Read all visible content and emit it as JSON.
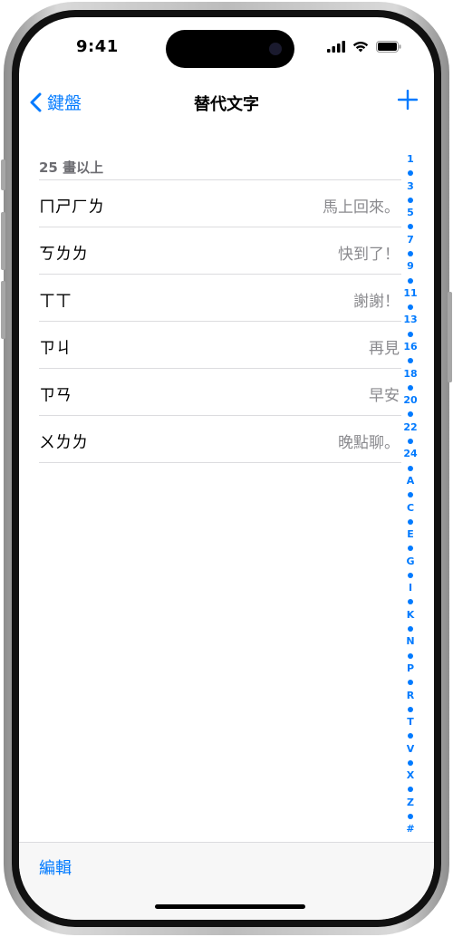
{
  "status": {
    "time": "9:41"
  },
  "nav": {
    "back_label": "鍵盤",
    "title": "替代文字"
  },
  "section": {
    "header": "25 畫以上"
  },
  "rows": [
    {
      "shortcut": "ㄇㄕㄏㄌ",
      "phrase": "馬上回來。"
    },
    {
      "shortcut": "ㄎㄌㄌ",
      "phrase": "快到了！"
    },
    {
      "shortcut": "ㄒㄒ",
      "phrase": "謝謝！"
    },
    {
      "shortcut": "ㄗㄐ",
      "phrase": "再見"
    },
    {
      "shortcut": "ㄗㄢ",
      "phrase": "早安"
    },
    {
      "shortcut": "ㄨㄌㄌ",
      "phrase": "晚點聊。"
    }
  ],
  "index": [
    "1",
    "3",
    "5",
    "7",
    "9",
    "11",
    "13",
    "16",
    "18",
    "20",
    "22",
    "24",
    "A",
    "C",
    "E",
    "G",
    "I",
    "K",
    "N",
    "P",
    "R",
    "T",
    "V",
    "X",
    "Z",
    "#"
  ],
  "toolbar": {
    "edit_label": "編輯"
  },
  "colors": {
    "accent": "#007aff",
    "secondary_text": "#8a8a8e"
  }
}
